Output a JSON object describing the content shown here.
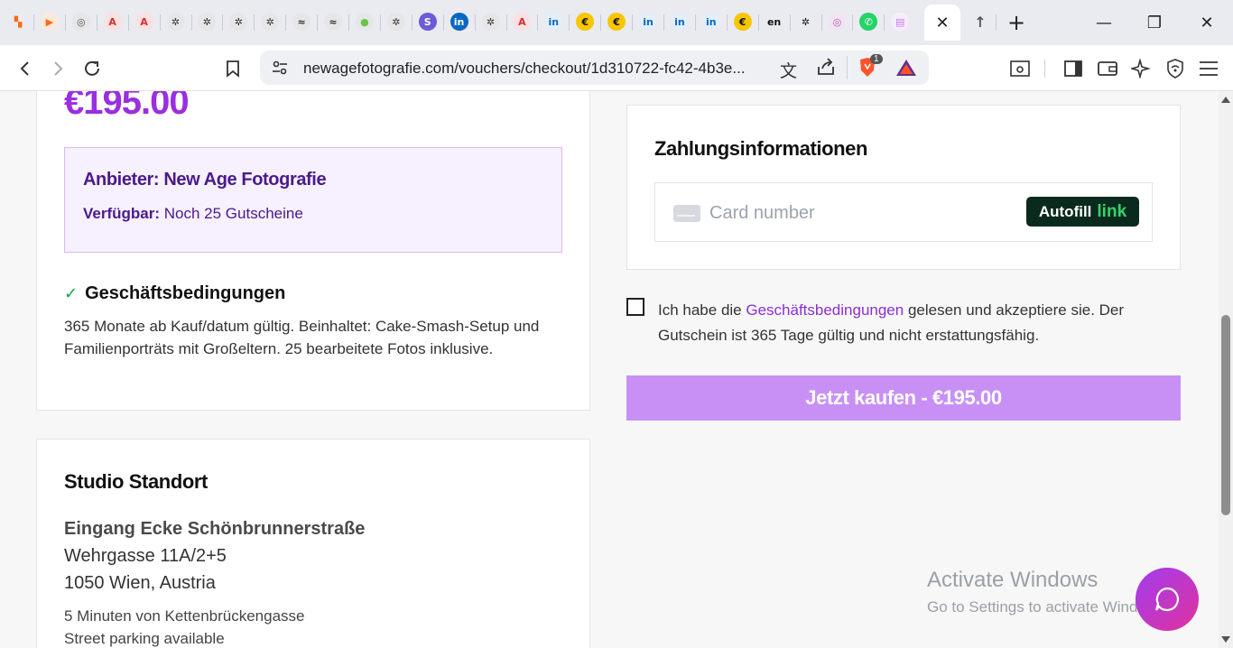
{
  "browser": {
    "tab_icons": [
      {
        "name": "brand-orange-icon",
        "glyph": "▚",
        "color": "#ff6a13",
        "bg": "transparent"
      },
      {
        "name": "play-icon",
        "glyph": "▶",
        "color": "#ff6a13",
        "bg": "#fde9dc"
      },
      {
        "name": "chatgpt-icon",
        "glyph": "◎",
        "color": "#555555",
        "bg": "#e6e6e6"
      },
      {
        "name": "angular-icon",
        "glyph": "A",
        "color": "#d32f2f",
        "bg": "#fbe1e1"
      },
      {
        "name": "angular-icon",
        "glyph": "A",
        "color": "#d32f2f",
        "bg": "#fbe1e1"
      },
      {
        "name": "openai-icon",
        "glyph": "✲",
        "color": "#333333",
        "bg": "#e6e6e6"
      },
      {
        "name": "openai-icon",
        "glyph": "✲",
        "color": "#333333",
        "bg": "#e6e6e6"
      },
      {
        "name": "openai-icon",
        "glyph": "✲",
        "color": "#333333",
        "bg": "#e6e6e6"
      },
      {
        "name": "openai-icon",
        "glyph": "✲",
        "color": "#333333",
        "bg": "#e6e6e6"
      },
      {
        "name": "copilot-icon",
        "glyph": "≈",
        "color": "#333333",
        "bg": "#e6e6e6"
      },
      {
        "name": "copilot-icon",
        "glyph": "≈",
        "color": "#333333",
        "bg": "#e6e6e6"
      },
      {
        "name": "green-circle-icon",
        "glyph": "●",
        "color": "#6cc24a",
        "bg": "#e6e6e6"
      },
      {
        "name": "openai-icon",
        "glyph": "✲",
        "color": "#333333",
        "bg": "#e6e6e6"
      },
      {
        "name": "s-coin-icon",
        "glyph": "S",
        "color": "#ffffff",
        "bg": "#6b5bd6"
      },
      {
        "name": "linkedin-icon",
        "glyph": "in",
        "color": "#ffffff",
        "bg": "#0a66c2"
      },
      {
        "name": "openai-icon",
        "glyph": "✲",
        "color": "#333333",
        "bg": "#e6e6e6"
      },
      {
        "name": "angular-icon",
        "glyph": "A",
        "color": "#d32f2f",
        "bg": "#fbe1e1"
      },
      {
        "name": "linkedin-icon",
        "glyph": "in",
        "color": "#0a66c2",
        "bg": "#e3eef9"
      },
      {
        "name": "euro-coin-icon",
        "glyph": "€",
        "color": "#111111",
        "bg": "#f7c600"
      },
      {
        "name": "euro-coin-icon",
        "glyph": "€",
        "color": "#111111",
        "bg": "#f7c600"
      },
      {
        "name": "linkedin-icon",
        "glyph": "in",
        "color": "#0a66c2",
        "bg": "#e3eef9"
      },
      {
        "name": "linkedin-icon",
        "glyph": "in",
        "color": "#0a66c2",
        "bg": "#e3eef9"
      },
      {
        "name": "linkedin-icon",
        "glyph": "in",
        "color": "#0a66c2",
        "bg": "#e3eef9"
      },
      {
        "name": "euro-coin-icon",
        "glyph": "€",
        "color": "#111111",
        "bg": "#f7c600"
      },
      {
        "name": "en-dict-icon",
        "glyph": "en",
        "color": "#111111",
        "bg": "transparent"
      },
      {
        "name": "openai-icon",
        "glyph": "✲",
        "color": "#111111",
        "bg": "transparent"
      },
      {
        "name": "pink-circle-icon",
        "glyph": "◎",
        "color": "#b05bb0",
        "bg": "#f2e3f2"
      },
      {
        "name": "whatsapp-icon",
        "glyph": "✆",
        "color": "#ffffff",
        "bg": "#25d366"
      },
      {
        "name": "site-favicon-icon",
        "glyph": "▤",
        "color": "#c77de8",
        "bg": "#f6ecfc"
      }
    ],
    "active_tab_close": "✕",
    "new_tab": "+",
    "url": "newagefotografie.com/vouchers/checkout/1d310722-fc42-4b3e...",
    "brave_badge": "1"
  },
  "voucher": {
    "price": "€195.00",
    "provider_label": "Anbieter: New Age Fotografie",
    "available_label": "Verfügbar:",
    "available_value": "Noch 25 Gutscheine",
    "terms_heading": "Geschäftsbedingungen",
    "terms_text": "365 Monate ab Kauf/datum gültig. Beinhaltet: Cake-Smash-Setup und Familienporträts mit Großeltern. 25 bearbeitete Fotos inklusive."
  },
  "studio": {
    "title": "Studio Standort",
    "line1": "Eingang Ecke Schönbrunnerstraße",
    "line2": "Wehrgasse 11A/2+5",
    "line3": "1050 Wien, Austria",
    "line4": "5 Minuten von Kettenbrückengasse",
    "line5": "Street parking available"
  },
  "payment": {
    "title": "Zahlungsinformationen",
    "card_placeholder": "Card number",
    "autofill_label": "Autofill",
    "autofill_link": "link",
    "agree_prefix": "Ich habe die ",
    "agree_link": "Geschäftsbedingungen",
    "agree_suffix": " gelesen und akzeptiere sie. Der Gutschein ist 365 Tage gültig und nicht erstattungsfähig.",
    "buy_button": "Jetzt kaufen - €195.00"
  },
  "overlay": {
    "activate_title": "Activate Windows",
    "activate_sub": "Go to Settings to activate Windows."
  },
  "colors": {
    "accent": "#9a2ee0",
    "button": "#c890f4",
    "provider_bg": "#f7f0fe"
  }
}
